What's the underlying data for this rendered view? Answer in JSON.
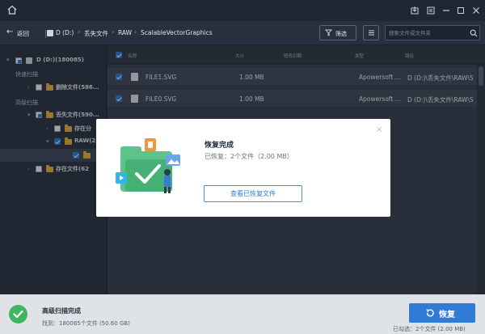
{
  "nav": {
    "back_label": "返回",
    "path": [
      "D (D:)",
      "丢失文件",
      "RAW",
      "ScalableVectorGraphics"
    ],
    "filter_label": "筛选",
    "search_placeholder": "搜索文件或文件夹"
  },
  "sidebar": {
    "drive_label": "D (D:)(180085)",
    "quick_scan_label": "快速扫描",
    "deleted_files_label": "删除文件(586...",
    "advanced_scan_label": "高级扫描",
    "lost_files_label": "丢失文件(590...",
    "existing_partition_label": "存在分",
    "raw_label": "RAW(2",
    "existing_files_label": "存在文件(62"
  },
  "list": {
    "columns": [
      "名称",
      "大小",
      "修改日期",
      "类型",
      "路径"
    ],
    "rows": [
      {
        "name": "FILE1.SVG",
        "size": "1.00 MB",
        "type": "Apowersoft ...",
        "path": "D (D:)\\丢失文件\\RAW\\S"
      },
      {
        "name": "FILE0.SVG",
        "size": "1.00 MB",
        "type": "Apowersoft ...",
        "path": "D (D:)\\丢失文件\\RAW\\S"
      }
    ]
  },
  "dialog": {
    "title": "恢复完成",
    "subtitle": "已恢复：2个文件（2.00 MB）",
    "view_button": "查看已恢复文件"
  },
  "footer": {
    "status_title": "高级扫描完成",
    "status_detail": "找到：180085个文件 (50.60 GB)",
    "recover_label": "恢复",
    "selected_info": "已勾选：2个文件 (2.00 MB)"
  },
  "colors": {
    "accent": "#2f7bd6",
    "success": "#3eb55f",
    "folder": "#e8b23a"
  }
}
